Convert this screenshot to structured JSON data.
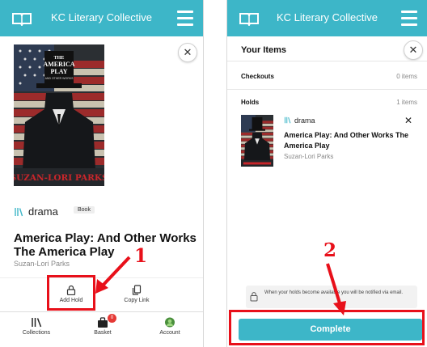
{
  "app": {
    "title": "KC Literary Collective"
  },
  "book_detail": {
    "format_label": "drama",
    "format_badge": "Book",
    "title": "America Play: And Other Works The America Play",
    "author": "Suzan-Lori Parks",
    "cover_text": {
      "title_line1": "THE",
      "title_line2": "AMERICA",
      "title_line3": "PLAY",
      "subtitle": "AND OTHER WORKS",
      "author": "SUZAN-LORI PARKS"
    },
    "actions": [
      {
        "label": "Add Hold",
        "icon": "lock-icon"
      },
      {
        "label": "Copy Link",
        "icon": "copy-icon"
      }
    ],
    "close_icon": "close-icon"
  },
  "bottom_nav": {
    "items": [
      {
        "label": "Collections",
        "icon": "shelf-icon"
      },
      {
        "label": "Basket",
        "icon": "basket-icon",
        "badge": "0"
      },
      {
        "label": "Account",
        "icon": "avatar-icon"
      }
    ]
  },
  "your_items": {
    "title": "Your Items",
    "checkouts_label": "Checkouts",
    "checkouts_count": "0 items",
    "holds_label": "Holds",
    "holds_count": "1 items",
    "hold": {
      "format_label": "drama",
      "title": "America Play: And Other Works The America Play",
      "author": "Suzan-Lori Parks"
    },
    "notice_text": "When your holds become available you will be notified via email.",
    "complete_label": "Complete"
  },
  "annotations": {
    "step1": "1",
    "step2": "2"
  },
  "colors": {
    "primary": "#3db6c8",
    "annotation": "#e8101a",
    "badge": "#e53935"
  }
}
